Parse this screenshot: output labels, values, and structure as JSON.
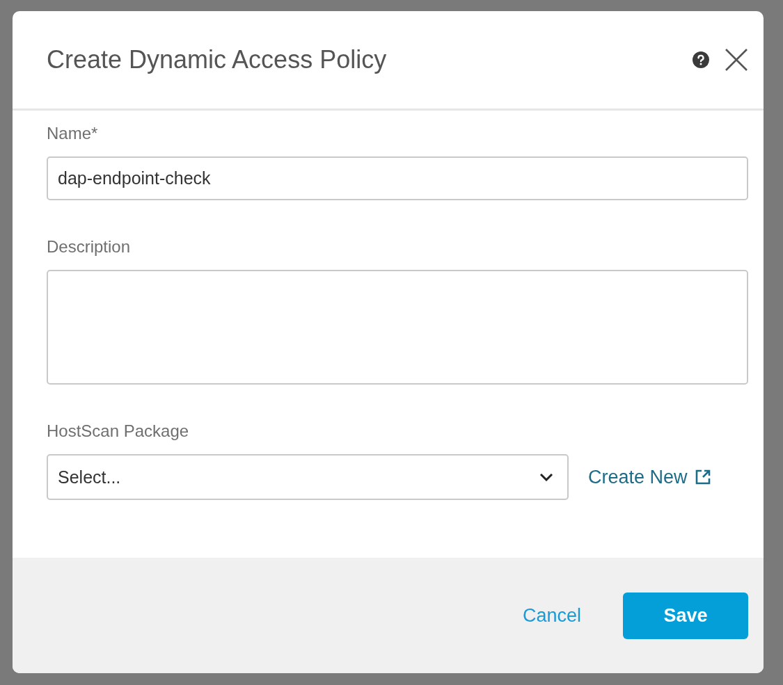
{
  "dialog": {
    "title": "Create Dynamic Access Policy"
  },
  "fields": [
    {
      "kind": "text",
      "label": "Name*",
      "value": "dap-endpoint-check"
    },
    {
      "kind": "textarea",
      "label": "Description"
    },
    {
      "kind": "select",
      "label": "HostScan Package",
      "placeholder": "Select...",
      "link": "Create New"
    }
  ],
  "buttons": [
    {
      "kind": "link",
      "label": "Cancel"
    },
    {
      "kind": "primary",
      "label": "Save"
    }
  ]
}
